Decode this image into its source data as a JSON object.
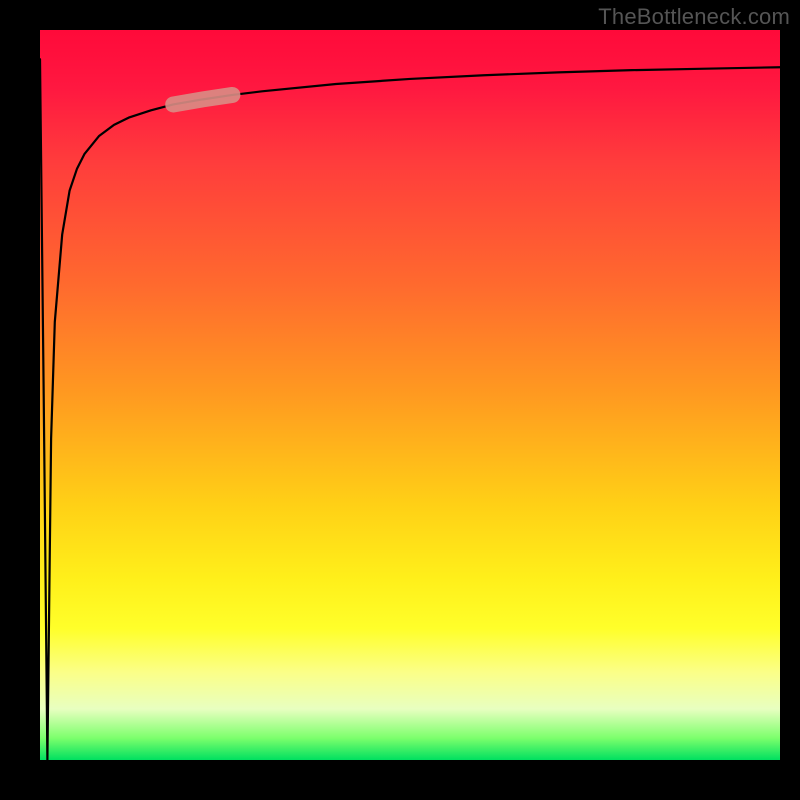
{
  "attribution": "TheBottleneck.com",
  "chart_data": {
    "type": "line",
    "title": "",
    "xlabel": "",
    "ylabel": "",
    "xlim": [
      0,
      100
    ],
    "ylim": [
      0,
      100
    ],
    "x": [
      0,
      0.5,
      1,
      1.5,
      2,
      3,
      4,
      5,
      6,
      8,
      10,
      12,
      15,
      18,
      22,
      26,
      30,
      40,
      50,
      60,
      70,
      80,
      90,
      100
    ],
    "values": [
      96,
      50,
      0,
      44,
      60,
      72,
      78,
      81,
      83,
      85.5,
      87,
      88,
      89,
      89.8,
      90.5,
      91.1,
      91.6,
      92.6,
      93.3,
      93.8,
      94.2,
      94.5,
      94.7,
      94.9
    ],
    "highlight_segment": {
      "x_start": 18,
      "x_end": 26
    },
    "colors": {
      "curve": "#000000",
      "highlight": "#d98d85"
    }
  }
}
